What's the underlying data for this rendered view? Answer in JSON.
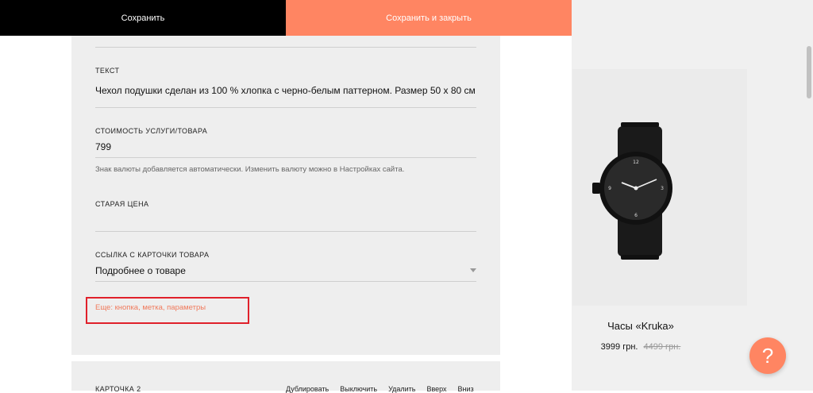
{
  "toolbar": {
    "save_label": "Сохранить",
    "save_close_label": "Сохранить и закрыть"
  },
  "form": {
    "text_label": "ТЕКСТ",
    "text_value": "Чехол подушки сделан из 100 % хлопка с черно-белым паттерном. Размер 50 х 80 см",
    "price_label": "СТОИМОСТЬ УСЛУГИ/ТОВАРА",
    "price_value": "799",
    "price_hint": "Знак валюты добавляется автоматически. Изменить валюту можно в Настройках сайта.",
    "old_price_label": "СТАРАЯ ЦЕНА",
    "old_price_value": "",
    "link_label": "ССЫЛКА С КАРТОЧКИ ТОВАРА",
    "link_value": "Подробнее о товаре",
    "more_link": "Еще: кнопка, метка, параметры"
  },
  "card2": {
    "title": "КАРТОЧКА 2",
    "actions": [
      "Дублировать",
      "Выключить",
      "Удалить",
      "Вверх",
      "Вниз"
    ]
  },
  "preview": {
    "product_title": "Часы «Kruka»",
    "price": "3999 грн.",
    "old_price": "4499 грн.",
    "image_icon": "watch-image"
  },
  "help": {
    "label": "?"
  },
  "colors": {
    "accent": "#ff8562",
    "toolbar_dark": "#000000",
    "highlight": "#e0202a"
  }
}
